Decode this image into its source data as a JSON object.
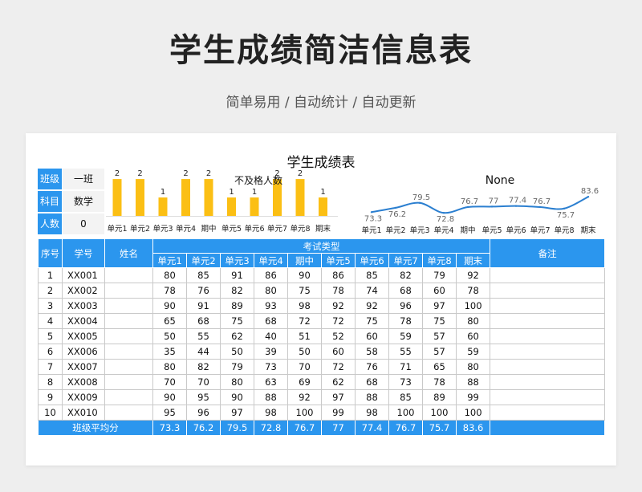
{
  "page": {
    "title": "学生成绩简洁信息表",
    "subtitle": "简单易用 / 自动统计 / 自动更新"
  },
  "sheet": {
    "title": "学生成绩表",
    "info": [
      {
        "key": "班级",
        "value": "一班"
      },
      {
        "key": "科目",
        "value": "数学"
      },
      {
        "key": "人数",
        "value": "0"
      }
    ]
  },
  "chart_data": [
    {
      "type": "bar",
      "title": "不及格人数",
      "categories": [
        "单元1",
        "单元2",
        "单元3",
        "单元4",
        "期中",
        "单元5",
        "单元6",
        "单元7",
        "单元8",
        "期末"
      ],
      "values": [
        2,
        2,
        1,
        2,
        2,
        1,
        1,
        2,
        2,
        1
      ],
      "ylim": [
        0,
        2.7
      ],
      "color": "#fbbf14",
      "grid": false,
      "legend": "none"
    },
    {
      "type": "line",
      "title": "None",
      "categories": [
        "单元1",
        "单元2",
        "单元3",
        "单元4",
        "期中",
        "单元5",
        "单元6",
        "单元7",
        "单元8",
        "期末"
      ],
      "values": [
        73.3,
        76.2,
        79.5,
        72.8,
        76.7,
        77,
        77.4,
        76.7,
        75.7,
        83.6
      ],
      "ylim": [
        60,
        95
      ],
      "color": "#2b7fd0",
      "grid": false,
      "legend": "none"
    }
  ],
  "table": {
    "headers": {
      "seq": "序号",
      "id": "学号",
      "name": "姓名",
      "exam_group": "考试类型",
      "remark": "备注",
      "exams": [
        "单元1",
        "单元2",
        "单元3",
        "单元4",
        "期中",
        "单元5",
        "单元6",
        "单元7",
        "单元8",
        "期末"
      ]
    },
    "rows": [
      {
        "seq": "1",
        "id": "XX001",
        "name": "",
        "scores": [
          "80",
          "85",
          "91",
          "86",
          "90",
          "86",
          "85",
          "82",
          "79",
          "92"
        ],
        "remark": ""
      },
      {
        "seq": "2",
        "id": "XX002",
        "name": "",
        "scores": [
          "78",
          "76",
          "82",
          "80",
          "75",
          "78",
          "74",
          "68",
          "60",
          "78"
        ],
        "remark": ""
      },
      {
        "seq": "3",
        "id": "XX003",
        "name": "",
        "scores": [
          "90",
          "91",
          "89",
          "93",
          "98",
          "92",
          "92",
          "96",
          "97",
          "100"
        ],
        "remark": ""
      },
      {
        "seq": "4",
        "id": "XX004",
        "name": "",
        "scores": [
          "65",
          "68",
          "75",
          "68",
          "72",
          "72",
          "75",
          "78",
          "75",
          "80"
        ],
        "remark": ""
      },
      {
        "seq": "5",
        "id": "XX005",
        "name": "",
        "scores": [
          "50",
          "55",
          "62",
          "40",
          "51",
          "52",
          "60",
          "59",
          "57",
          "60"
        ],
        "remark": ""
      },
      {
        "seq": "6",
        "id": "XX006",
        "name": "",
        "scores": [
          "35",
          "44",
          "50",
          "39",
          "50",
          "60",
          "58",
          "55",
          "57",
          "59"
        ],
        "remark": ""
      },
      {
        "seq": "7",
        "id": "XX007",
        "name": "",
        "scores": [
          "80",
          "82",
          "79",
          "73",
          "70",
          "72",
          "76",
          "71",
          "65",
          "80"
        ],
        "remark": ""
      },
      {
        "seq": "8",
        "id": "XX008",
        "name": "",
        "scores": [
          "70",
          "70",
          "80",
          "63",
          "69",
          "62",
          "68",
          "73",
          "78",
          "88"
        ],
        "remark": ""
      },
      {
        "seq": "9",
        "id": "XX009",
        "name": "",
        "scores": [
          "90",
          "95",
          "90",
          "88",
          "92",
          "97",
          "88",
          "85",
          "89",
          "99"
        ],
        "remark": ""
      },
      {
        "seq": "10",
        "id": "XX010",
        "name": "",
        "scores": [
          "95",
          "96",
          "97",
          "98",
          "100",
          "99",
          "98",
          "100",
          "100",
          "100"
        ],
        "remark": ""
      }
    ],
    "average": {
      "label": "班级平均分",
      "scores": [
        "73.3",
        "76.2",
        "79.5",
        "72.8",
        "76.7",
        "77",
        "77.4",
        "76.7",
        "75.7",
        "83.6"
      ]
    }
  }
}
